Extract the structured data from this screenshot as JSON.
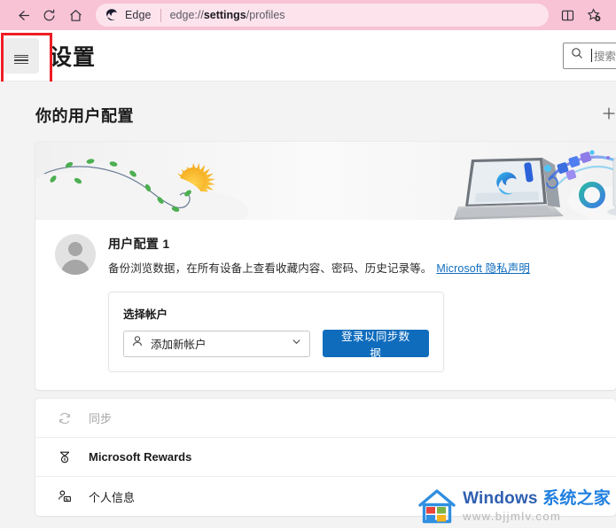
{
  "browser": {
    "back_icon": "back-arrow-icon",
    "refresh_icon": "refresh-icon",
    "home_icon": "home-icon",
    "brand": "Edge",
    "url_prefix": "edge://",
    "url_bold": "settings",
    "url_suffix": "/profiles",
    "url_full": "edge://settings/profiles",
    "split_screen_icon": "split-screen-icon",
    "favorites_icon": "add-favorite-star-icon",
    "toolbar_color": "#f8c3d4",
    "omnibox_color": "#fde3ec"
  },
  "settings_header": {
    "menu_icon": "hamburger-menu-icon",
    "title": "设置",
    "search": {
      "icon": "search-icon",
      "placeholder": "搜索设",
      "value": ""
    },
    "annotation_color": "#ee1d24"
  },
  "profiles_page": {
    "section_title": "你的用户配置",
    "add_profile_icon": "plus-icon",
    "banner": {
      "alt": "profile-banner-illustration",
      "elements": [
        "clouds",
        "sun",
        "leaf-vine",
        "laptop-with-edge-logo",
        "sync-arc",
        "phone-with-edge-logo"
      ]
    },
    "profile": {
      "avatar_icon": "default-avatar-icon",
      "name": "用户配置 1",
      "description": "备份浏览数据，在所有设备上查看收藏内容、密码、历史记录等。",
      "privacy_link": "Microsoft 隐私声明"
    },
    "account_box": {
      "label": "选择帐户",
      "select": {
        "icon": "person-icon",
        "value": "添加新帐户",
        "chevron_icon": "chevron-down-icon"
      },
      "signin_button": "登录以同步数据",
      "accent_color": "#0f6cbd"
    },
    "settings_list": [
      {
        "icon": "sync-icon",
        "label": "同步",
        "state": "disabled"
      },
      {
        "icon": "rewards-medal-icon",
        "label": "Microsoft Rewards",
        "state": "bold"
      },
      {
        "icon": "personal-info-icon",
        "label": "个人信息",
        "state": "normal"
      }
    ]
  },
  "watermark": {
    "logo_icon": "windows-house-logo-icon",
    "brand_en": "Windows ",
    "brand_cn": "系统之家",
    "url": "www.bjjmlv.com"
  }
}
